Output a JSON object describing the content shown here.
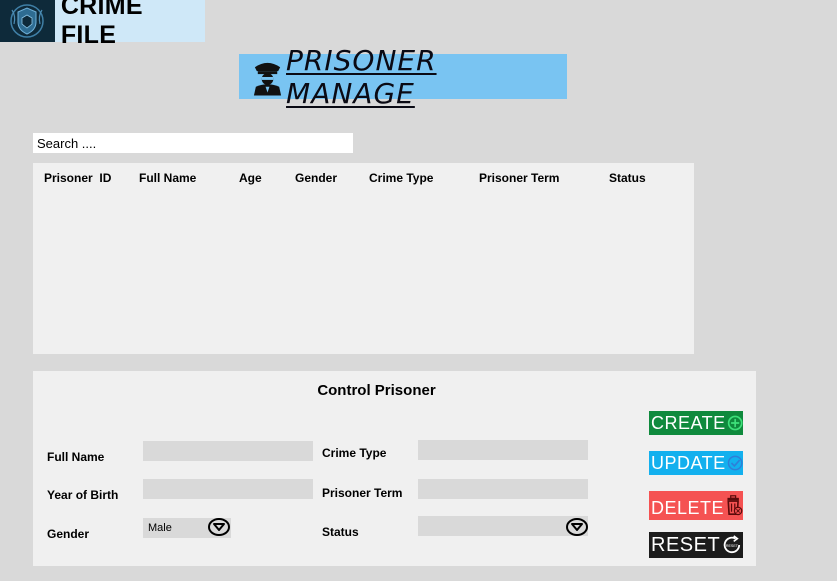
{
  "header": {
    "title": "CRIME FILE",
    "logo_icon": "crime-file-crest-icon"
  },
  "banner": {
    "title": "PRISONER MANAGE",
    "icon": "police-officer-icon"
  },
  "search": {
    "placeholder": "Search ...."
  },
  "table": {
    "columns": [
      "Prisoner  ID",
      "Full Name",
      "Age",
      "Gender",
      "Crime Type",
      "Prisoner Term",
      "Status"
    ],
    "rows": []
  },
  "control": {
    "title": "Control Prisoner",
    "fields": {
      "full_name": {
        "label": "Full Name",
        "value": ""
      },
      "year_of_birth": {
        "label": "Year of Birth",
        "value": ""
      },
      "gender": {
        "label": "Gender",
        "value": "Male"
      },
      "crime_type": {
        "label": "Crime Type",
        "value": ""
      },
      "prisoner_term": {
        "label": "Prisoner Term",
        "value": ""
      },
      "status": {
        "label": "Status",
        "value": ""
      }
    },
    "buttons": {
      "create": "CREATE",
      "update": "UPDATE",
      "delete": "DELETE",
      "reset": "RESET",
      "reset_icon_text": "RESET"
    }
  },
  "colors": {
    "background": "#d9d9d9",
    "panel": "#f0f0f0",
    "banner": "#79c4f2",
    "create": "#0f8a3d",
    "update": "#13b0ee",
    "delete": "#f55252",
    "reset": "#1c1c1c"
  }
}
